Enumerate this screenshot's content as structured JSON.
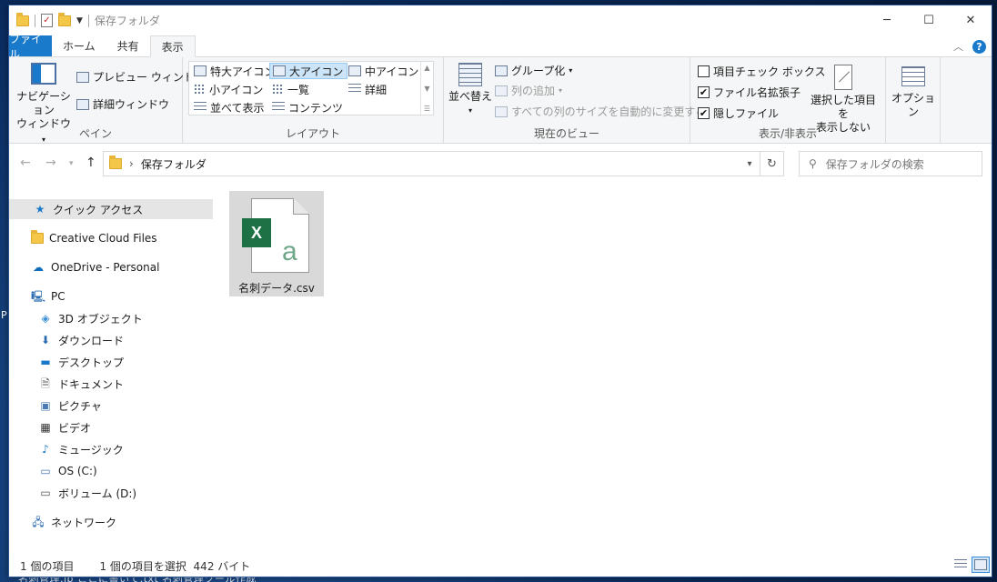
{
  "window": {
    "title": "保存フォルダ"
  },
  "tabs": {
    "file": "ファイル",
    "home": "ホーム",
    "share": "共有",
    "view": "表示"
  },
  "ribbon": {
    "pane": {
      "nav_pane_line1": "ナビゲーション",
      "nav_pane_line2": "ウィンドウ",
      "preview_pane": "プレビュー ウィンドウ",
      "details_pane": "詳細ウィンドウ",
      "label": "ペイン"
    },
    "layout": {
      "items": [
        "特大アイコン",
        "大アイコン",
        "中アイコン",
        "小アイコン",
        "一覧",
        "詳細",
        "並べて表示",
        "コンテンツ"
      ],
      "selected": "大アイコン",
      "label": "レイアウト"
    },
    "current_view": {
      "sort_line1": "並べ替え",
      "group_by": "グループ化",
      "add_columns": "列の追加",
      "size_all_columns": "すべての列のサイズを自動的に変更する",
      "label": "現在のビュー"
    },
    "show_hide": {
      "item_checkboxes": "項目チェック ボックス",
      "file_name_extensions": "ファイル名拡張子",
      "hidden_items": "隠しファイル",
      "item_checkboxes_checked": false,
      "file_name_extensions_checked": true,
      "hidden_items_checked": true,
      "hide_selected_line1": "選択した項目を",
      "hide_selected_line2": "表示しない",
      "label": "表示/非表示"
    },
    "options": {
      "label": "オプション"
    }
  },
  "address": {
    "path": "保存フォルダ",
    "search_placeholder": "保存フォルダの検索"
  },
  "sidebar": {
    "items": [
      {
        "label": "クイック アクセス",
        "icon": "star-icon",
        "selected": true
      },
      {
        "label": "Creative Cloud Files",
        "icon": "creative-cloud-folder-icon"
      },
      {
        "label": "OneDrive - Personal",
        "icon": "onedrive-cloud-icon"
      },
      {
        "label": "PC",
        "icon": "computer-icon"
      },
      {
        "label": "3D オブジェクト",
        "icon": "3d-objects-icon"
      },
      {
        "label": "ダウンロード",
        "icon": "download-arrow-icon"
      },
      {
        "label": "デスクトップ",
        "icon": "desktop-icon"
      },
      {
        "label": "ドキュメント",
        "icon": "document-icon"
      },
      {
        "label": "ピクチャ",
        "icon": "pictures-icon"
      },
      {
        "label": "ビデオ",
        "icon": "video-icon"
      },
      {
        "label": "ミュージック",
        "icon": "music-note-icon"
      },
      {
        "label": "OS (C:)",
        "icon": "drive-c-icon"
      },
      {
        "label": "ボリューム (D:)",
        "icon": "drive-d-icon"
      },
      {
        "label": "ネットワーク",
        "icon": "network-icon"
      }
    ]
  },
  "files": [
    {
      "name": "名刺データ.csv",
      "icon": "excel-csv-icon"
    }
  ],
  "status": {
    "item_count": "1 個の項目",
    "selection": "1 個の項目を選択",
    "size": "442 バイト"
  },
  "desktop": {
    "edge_text_left": "P",
    "bottom_text": "名刺管理.jp      ここに書いて.txt      名刺管理ツール作成"
  },
  "colors": {
    "accent": "#1979ca",
    "excel_green": "#1e7145",
    "folder_yellow": "#f5c748",
    "selection_bg": "#cce4f7"
  }
}
